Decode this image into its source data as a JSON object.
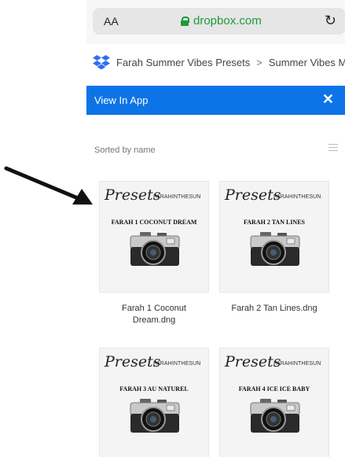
{
  "browser": {
    "text_size_label": "AA",
    "url": "dropbox.com",
    "reload_icon": "reload-icon"
  },
  "breadcrumb": {
    "logo": "dropbox-logo",
    "items": [
      "Farah Summer Vibes Presets",
      "Summer Vibes M"
    ],
    "separator": ">"
  },
  "banner": {
    "label": "View In App",
    "close_glyph": "✕"
  },
  "sort": {
    "label": "Sorted by name",
    "view_icon": "list-view-icon"
  },
  "files": [
    {
      "thumb_script": "Presets",
      "thumb_handle": "FARAHINTHESUN",
      "thumb_title": "FARAH 1 COCONUT DREAM",
      "caption_line1": "Farah 1 Coconut",
      "caption_line2": "Dream.dng"
    },
    {
      "thumb_script": "Presets",
      "thumb_handle": "FARAHINTHESUN",
      "thumb_title": "FARAH 2 TAN LINES",
      "caption_line1": "Farah 2 Tan Lines.dng",
      "caption_line2": ""
    },
    {
      "thumb_script": "Presets",
      "thumb_handle": "FARAHINTHESUN",
      "thumb_title": "FARAH 3 AU NATUREL",
      "caption_line1": "",
      "caption_line2": ""
    },
    {
      "thumb_script": "Presets",
      "thumb_handle": "FARAHINTHESUN",
      "thumb_title": "FARAH 4 ICE ICE BABY",
      "caption_line1": "",
      "caption_line2": ""
    }
  ],
  "colors": {
    "banner": "#0d74e7",
    "url": "#1c9a3a"
  }
}
